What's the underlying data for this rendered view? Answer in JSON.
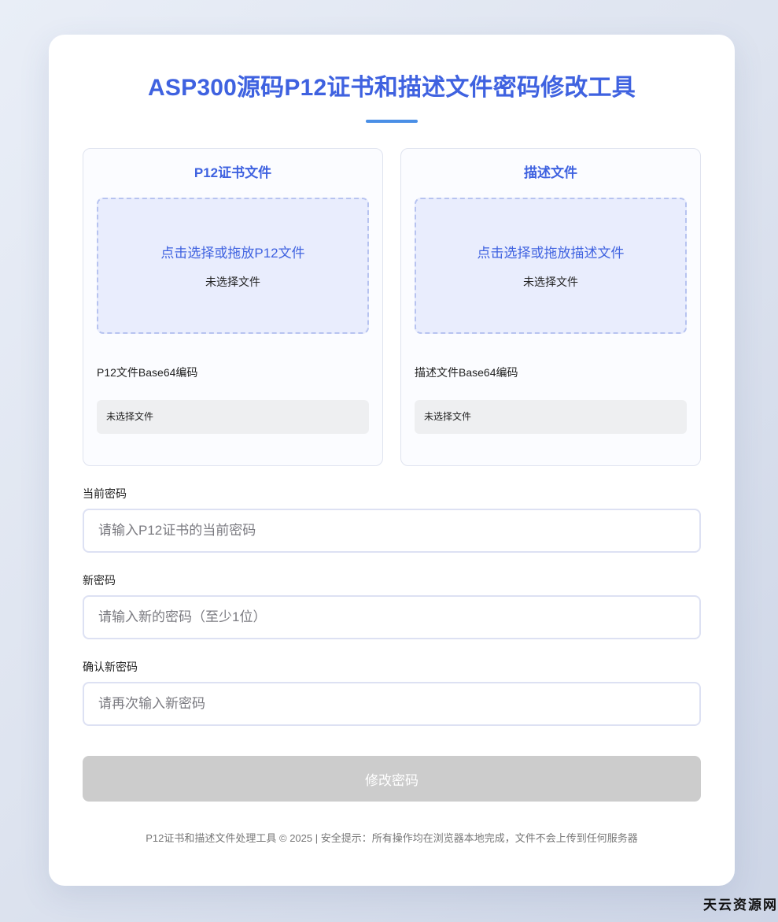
{
  "title": "ASP300源码P12证书和描述文件密码修改工具",
  "p12_panel": {
    "title": "P12证书文件",
    "drop_hint": "点击选择或拖放P12文件",
    "file_status": "未选择文件",
    "b64_label": "P12文件Base64编码",
    "b64_value": "未选择文件"
  },
  "profile_panel": {
    "title": "描述文件",
    "drop_hint": "点击选择或拖放描述文件",
    "file_status": "未选择文件",
    "b64_label": "描述文件Base64编码",
    "b64_value": "未选择文件"
  },
  "form": {
    "current_password": {
      "label": "当前密码",
      "placeholder": "请输入P12证书的当前密码",
      "value": ""
    },
    "new_password": {
      "label": "新密码",
      "placeholder": "请输入新的密码（至少1位）",
      "value": ""
    },
    "confirm_password": {
      "label": "确认新密码",
      "placeholder": "请再次输入新密码",
      "value": ""
    },
    "submit_label": "修改密码"
  },
  "footer": "P12证书和描述文件处理工具 © 2025 | 安全提示：所有操作均在浏览器本地完成，文件不会上传到任何服务器",
  "watermark": "天云资源网",
  "colors": {
    "accent": "#3f62e0",
    "underline": "#4a8fe6",
    "drop_zone_bg": "#e9edfd",
    "button_disabled": "#cccccc"
  }
}
